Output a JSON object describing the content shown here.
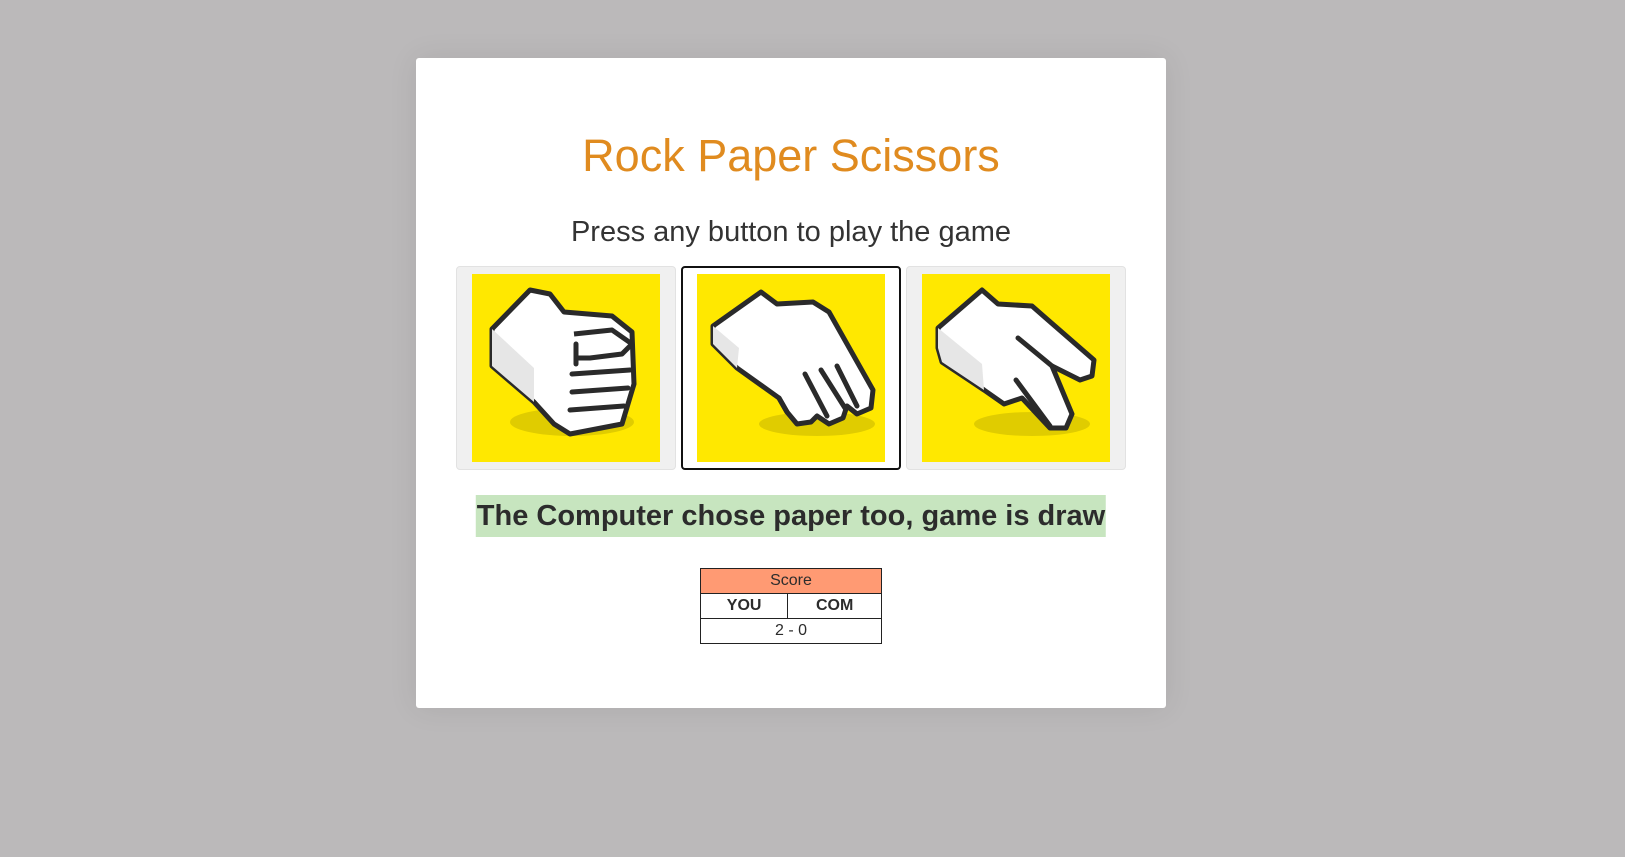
{
  "game": {
    "title": "Rock Paper Scissors",
    "instruction": "Press any button to play the game",
    "choices": [
      {
        "name": "rock",
        "icon": "rock-hand-icon",
        "selected": false
      },
      {
        "name": "paper",
        "icon": "paper-hand-icon",
        "selected": true
      },
      {
        "name": "scissors",
        "icon": "scissors-hand-icon",
        "selected": false
      }
    ],
    "result_message": "The Computer chose paper too, game is draw"
  },
  "score": {
    "header": "Score",
    "player_label": "YOU",
    "computer_label": "COM",
    "value": "2 - 0"
  },
  "colors": {
    "background": "#bbb9ba",
    "title": "#e08b1f",
    "choice_art": "#ffe800",
    "result_highlight": "#c7e5bf",
    "score_header": "#ff9a73"
  }
}
